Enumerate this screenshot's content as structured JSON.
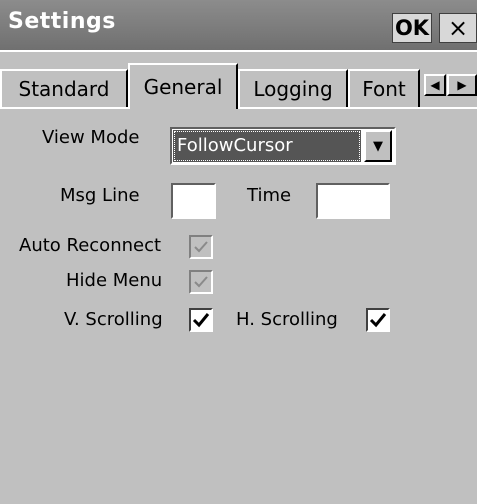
{
  "window": {
    "title": "Settings",
    "ok_label": "OK",
    "close_label": "×"
  },
  "tabs": [
    {
      "label": "Standard",
      "active": false
    },
    {
      "label": "General",
      "active": true
    },
    {
      "label": "Logging",
      "active": false
    },
    {
      "label": "Font",
      "active": false
    }
  ],
  "tab_scroll": {
    "left": "◀",
    "right": "▶"
  },
  "general": {
    "view_mode": {
      "label": "View Mode",
      "value": "FollowCursor",
      "dropdown_icon": "▼"
    },
    "msg_line": {
      "label": "Msg Line",
      "value": ""
    },
    "time": {
      "label": "Time",
      "value": ""
    },
    "auto_reconnect": {
      "label": "Auto Reconnect",
      "checked": true,
      "enabled": false
    },
    "hide_menu": {
      "label": "Hide Menu",
      "checked": true,
      "enabled": false
    },
    "v_scrolling": {
      "label": "V. Scrolling",
      "checked": true,
      "enabled": true
    },
    "h_scrolling": {
      "label": "H. Scrolling",
      "checked": true,
      "enabled": true
    }
  },
  "colors": {
    "titlebar": "#7f7f7f",
    "background": "#c0c0c0",
    "selection": "#555555"
  }
}
